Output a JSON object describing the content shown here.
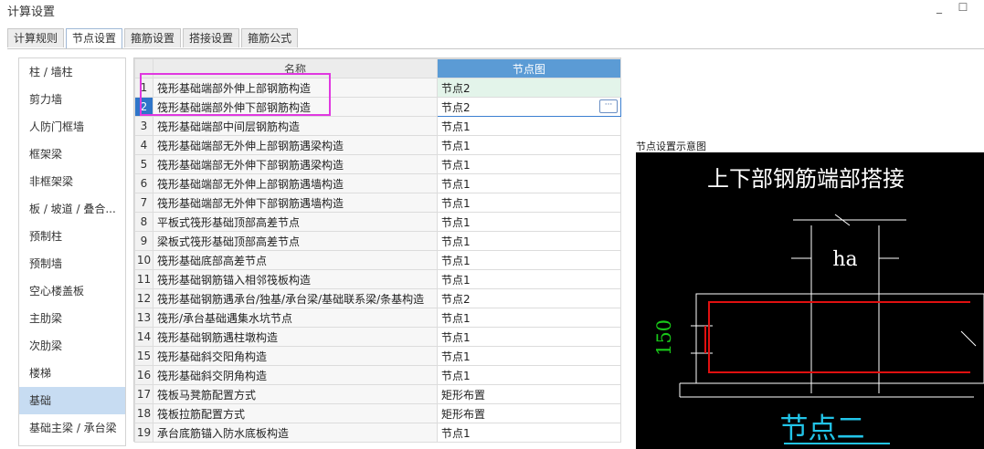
{
  "window": {
    "title": "计算设置",
    "minimize": "_",
    "maximize": "☐"
  },
  "tabs": [
    {
      "label": "计算规则",
      "active": false
    },
    {
      "label": "节点设置",
      "active": true
    },
    {
      "label": "箍筋设置",
      "active": false
    },
    {
      "label": "搭接设置",
      "active": false
    },
    {
      "label": "箍筋公式",
      "active": false
    }
  ],
  "sidebar": {
    "items": [
      {
        "label": "柱 / 墙柱"
      },
      {
        "label": "剪力墙"
      },
      {
        "label": "人防门框墙"
      },
      {
        "label": "框架梁"
      },
      {
        "label": "非框架梁"
      },
      {
        "label": "板 / 坡道 / 叠合..."
      },
      {
        "label": "预制柱"
      },
      {
        "label": "预制墙"
      },
      {
        "label": "空心楼盖板"
      },
      {
        "label": "主肋梁"
      },
      {
        "label": "次肋梁"
      },
      {
        "label": "楼梯"
      },
      {
        "label": "基础",
        "active": true
      },
      {
        "label": "基础主梁 / 承台梁"
      }
    ]
  },
  "grid": {
    "col_name": "名称",
    "col_node": "节点图",
    "rows": [
      {
        "n": "1",
        "name": "筏形基础端部外伸上部钢筋构造",
        "node": "节点2"
      },
      {
        "n": "2",
        "name": "筏形基础端部外伸下部钢筋构造",
        "node": "节点2"
      },
      {
        "n": "3",
        "name": "筏形基础端部中间层钢筋构造",
        "node": "节点1"
      },
      {
        "n": "4",
        "name": "筏形基础端部无外伸上部钢筋遇梁构造",
        "node": "节点1"
      },
      {
        "n": "5",
        "name": "筏形基础端部无外伸下部钢筋遇梁构造",
        "node": "节点1"
      },
      {
        "n": "6",
        "name": "筏形基础端部无外伸上部钢筋遇墙构造",
        "node": "节点1"
      },
      {
        "n": "7",
        "name": "筏形基础端部无外伸下部钢筋遇墙构造",
        "node": "节点1"
      },
      {
        "n": "8",
        "name": "平板式筏形基础顶部高差节点",
        "node": "节点1"
      },
      {
        "n": "9",
        "name": "梁板式筏形基础顶部高差节点",
        "node": "节点1"
      },
      {
        "n": "10",
        "name": "筏形基础底部高差节点",
        "node": "节点1"
      },
      {
        "n": "11",
        "name": "筏形基础钢筋锚入相邻筏板构造",
        "node": "节点1"
      },
      {
        "n": "12",
        "name": "筏形基础钢筋遇承台/独基/承台梁/基础联系梁/条基构造",
        "node": "节点2"
      },
      {
        "n": "13",
        "name": "筏形/承台基础遇集水坑节点",
        "node": "节点1"
      },
      {
        "n": "14",
        "name": "筏形基础钢筋遇柱墩构造",
        "node": "节点1"
      },
      {
        "n": "15",
        "name": "筏形基础斜交阳角构造",
        "node": "节点1"
      },
      {
        "n": "16",
        "name": "筏形基础斜交阴角构造",
        "node": "节点1"
      },
      {
        "n": "17",
        "name": "筏板马凳筋配置方式",
        "node": "矩形布置"
      },
      {
        "n": "18",
        "name": "筏板拉筋配置方式",
        "node": "矩形布置"
      },
      {
        "n": "19",
        "name": "承台底筋锚入防水底板构造",
        "node": "节点1"
      }
    ],
    "edit_button": "···"
  },
  "preview": {
    "label": "节点设置示意图",
    "heading": "上下部钢筋端部搭接",
    "dim_ha": "ha",
    "dim_150": "150",
    "caption": "节点二"
  },
  "colors": {
    "accent": "#5b9bd5",
    "selected_row": "#2f75c9",
    "callout": "#e038e0",
    "rebar": "#e01010",
    "dimension": "#19c819",
    "caption": "#22c4e8"
  }
}
